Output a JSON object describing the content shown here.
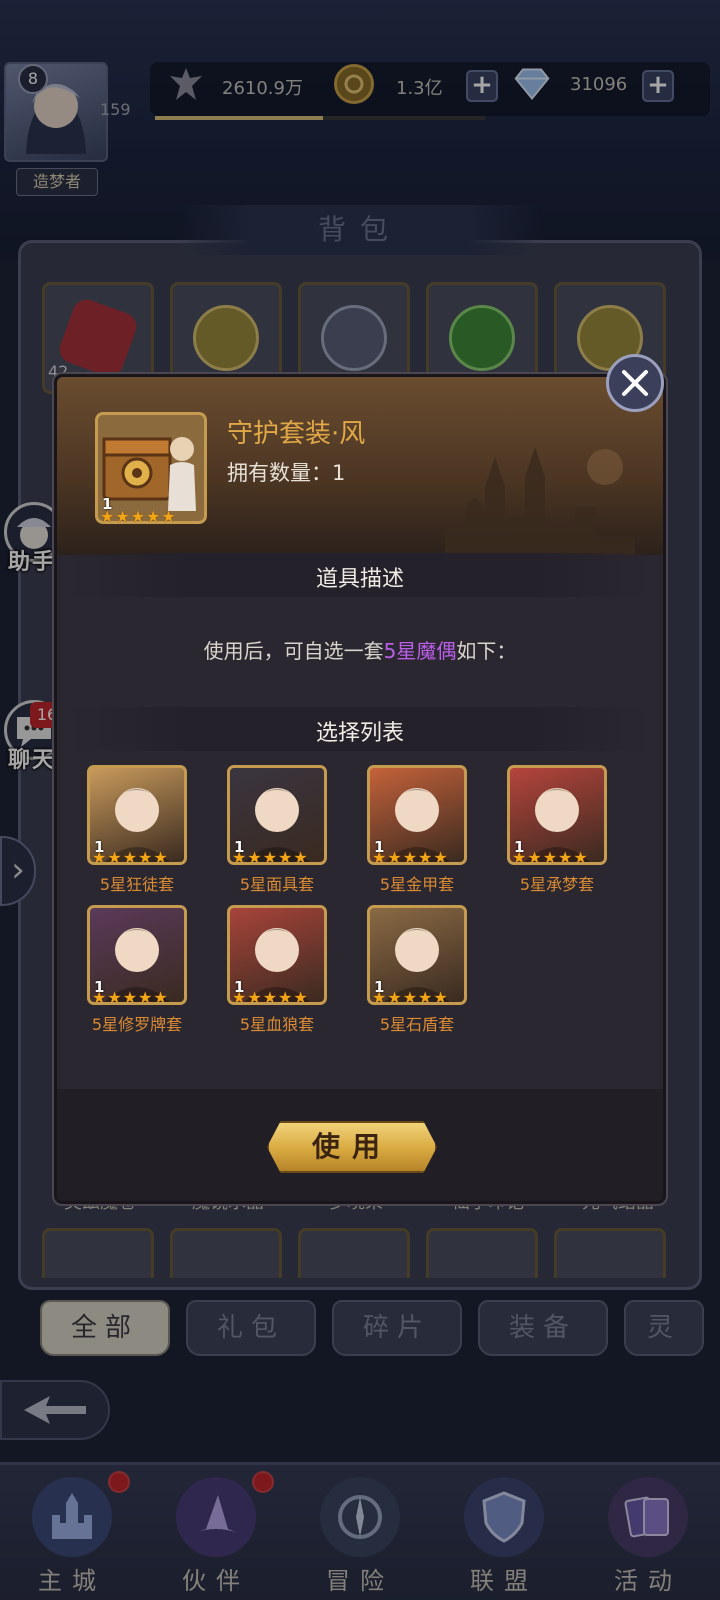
{
  "header": {
    "level": "8",
    "avatar_number": "159",
    "player_title": "造梦者",
    "power": "2610.9万",
    "gold": "1.3亿",
    "diamonds": "31096",
    "exp_progress": 0.51
  },
  "backpack": {
    "title": "背包",
    "first_item_count": "42",
    "item_labels": [
      "奥兹魔卷",
      "魔镜水晶",
      "梦境果",
      "仙子印记",
      "元气结晶"
    ],
    "tabs": [
      {
        "label": "全部",
        "active": true
      },
      {
        "label": "礼包",
        "active": false
      },
      {
        "label": "碎片",
        "active": false
      },
      {
        "label": "装备",
        "active": false
      },
      {
        "label": "灵",
        "active": false
      }
    ]
  },
  "side": {
    "assistant_label": "助手",
    "chat_label": "聊天",
    "chat_badge": "16"
  },
  "modal": {
    "item_name": "守护套装·风",
    "own_label": "拥有数量：",
    "own_count": "1",
    "item_count": "1",
    "item_stars": 5,
    "desc_section": "道具描述",
    "desc_prefix": "使用后，可自选一套",
    "desc_highlight": "5星魔偶",
    "desc_suffix": "如下：",
    "list_section": "选择列表",
    "choices": [
      {
        "label": "5星狂徒套",
        "count": "1",
        "color": "#c89a5c"
      },
      {
        "label": "5星面具套",
        "count": "1",
        "color": "#3a3540"
      },
      {
        "label": "5星金甲套",
        "count": "1",
        "color": "#c4623a"
      },
      {
        "label": "5星承梦套",
        "count": "1",
        "color": "#b5443c"
      },
      {
        "label": "5星修罗牌套",
        "count": "1",
        "color": "#5a3a5a"
      },
      {
        "label": "5星血狼套",
        "count": "1",
        "color": "#a8443a"
      },
      {
        "label": "5星石盾套",
        "count": "1",
        "color": "#8a6a44"
      }
    ],
    "use_button": "使用"
  },
  "nav": [
    {
      "label": "主城",
      "icon": "castle-icon",
      "dot": true
    },
    {
      "label": "伙伴",
      "icon": "witch-hat-icon",
      "dot": true
    },
    {
      "label": "冒险",
      "icon": "compass-icon",
      "dot": false
    },
    {
      "label": "联盟",
      "icon": "shield-icon",
      "dot": false
    },
    {
      "label": "活动",
      "icon": "cards-icon",
      "dot": false
    }
  ],
  "colors": {
    "gold_text": "#e0a847",
    "highlight_purple": "#b95fe8",
    "choice_label": "#d98a33",
    "star": "#f2a516"
  }
}
